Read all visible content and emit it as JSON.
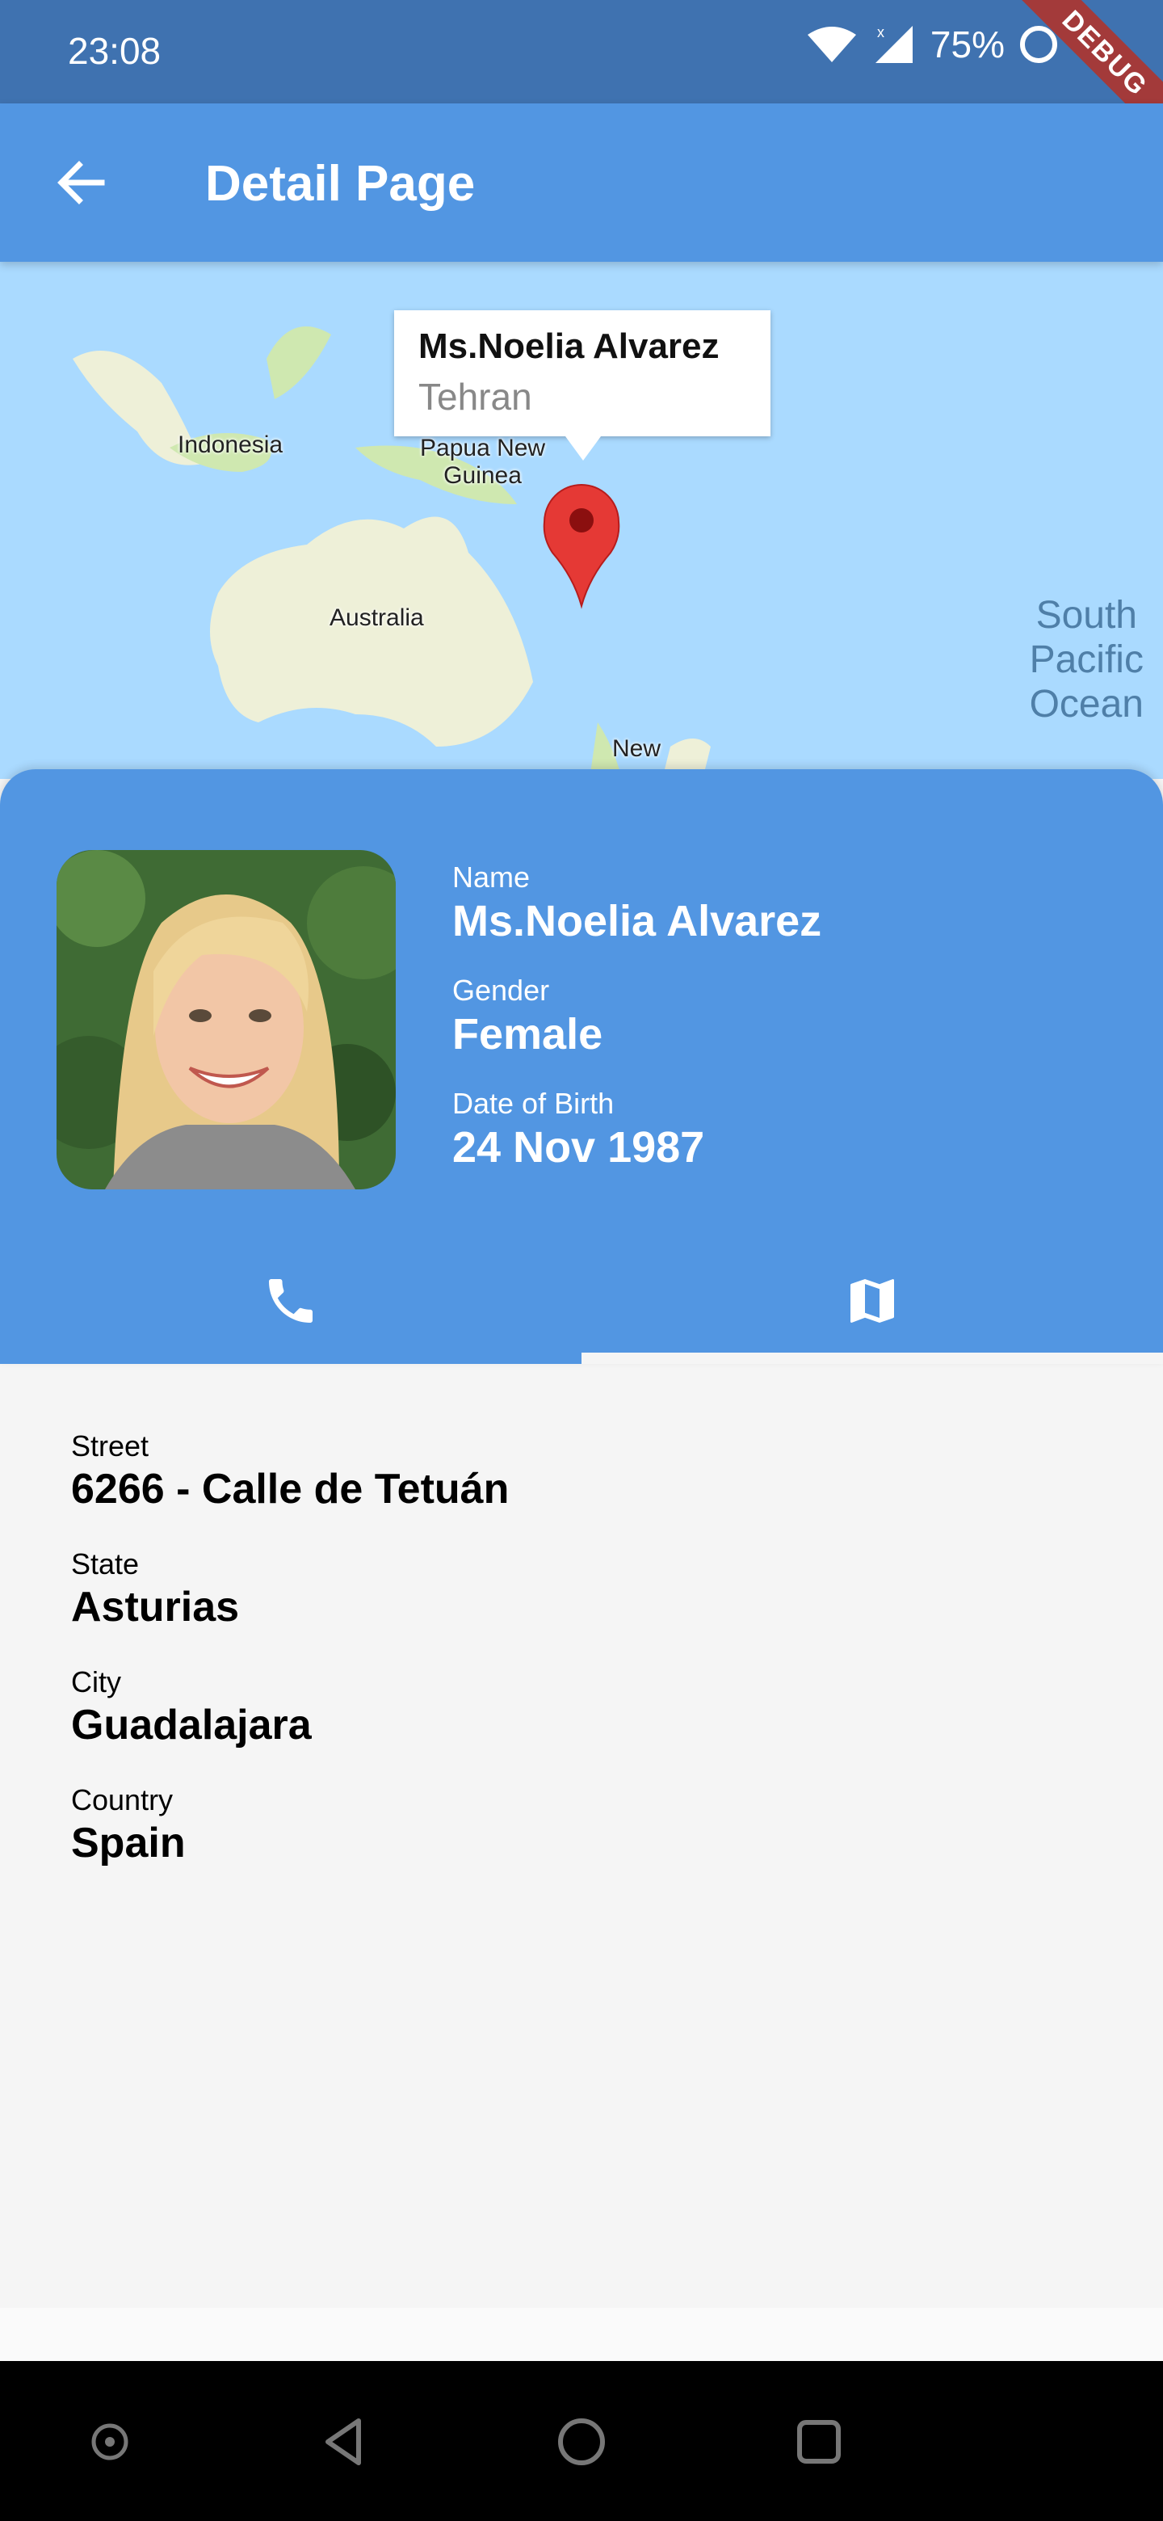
{
  "status_bar": {
    "time": "23:08",
    "battery": "75%",
    "debug": "DEBUG"
  },
  "app_bar": {
    "title": "Detail Page"
  },
  "map": {
    "labels": {
      "indonesia": "Indonesia",
      "papua_line1": "Papua New",
      "papua_line2": "Guinea",
      "australia": "Australia",
      "new_zealand": "New",
      "ocean_line1": "South",
      "ocean_line2": "Pacific",
      "ocean_line3": "Ocean"
    },
    "info_window": {
      "name": "Ms.Noelia Alvarez",
      "city": "Tehran"
    },
    "marker_color": "#e53935"
  },
  "profile": {
    "name_label": "Name",
    "name": "Ms.Noelia Alvarez",
    "gender_label": "Gender",
    "gender": "Female",
    "dob_label": "Date of Birth",
    "dob": "24 Nov 1987"
  },
  "tabs": [
    {
      "icon": "phone-icon",
      "selected": false
    },
    {
      "icon": "map-icon",
      "selected": true
    }
  ],
  "address": {
    "street_label": "Street",
    "street": "6266 - Calle de Tetuán",
    "state_label": "State",
    "state": "Asturias",
    "city_label": "City",
    "city": "Guadalajara",
    "country_label": "Country",
    "country": "Spain"
  },
  "colors": {
    "primary": "#5296e2",
    "status_bar": "#3f72b0",
    "background": "#f5f5f5"
  }
}
